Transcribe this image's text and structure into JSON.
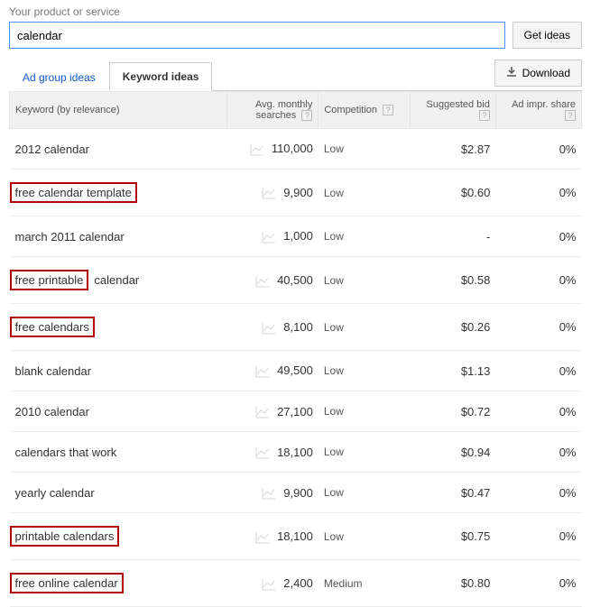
{
  "label": "Your product or service",
  "search": {
    "value": "calendar",
    "button": "Get ideas"
  },
  "tabs": {
    "ad_group": "Ad group ideas",
    "keyword": "Keyword ideas"
  },
  "download": "Download",
  "headers": {
    "keyword": "Keyword (by relevance)",
    "searches": "Avg. monthly searches",
    "competition": "Competition",
    "bid": "Suggested bid",
    "impr": "Ad impr. share"
  },
  "rows": [
    {
      "kw": "2012 calendar",
      "searches": "110,000",
      "comp": "Low",
      "bid": "$2.87",
      "impr": "0%",
      "hl": false
    },
    {
      "kw": "free calendar template",
      "searches": "9,900",
      "comp": "Low",
      "bid": "$0.60",
      "impr": "0%",
      "hl": true
    },
    {
      "kw": "march 2011 calendar",
      "searches": "1,000",
      "comp": "Low",
      "bid": "-",
      "impr": "0%",
      "hl": false
    },
    {
      "kw": "free printable calendar",
      "searches": "40,500",
      "comp": "Low",
      "bid": "$0.58",
      "impr": "0%",
      "hl": true,
      "hl_text": "free printable"
    },
    {
      "kw": "free calendars",
      "searches": "8,100",
      "comp": "Low",
      "bid": "$0.26",
      "impr": "0%",
      "hl": true
    },
    {
      "kw": "blank calendar",
      "searches": "49,500",
      "comp": "Low",
      "bid": "$1.13",
      "impr": "0%",
      "hl": false
    },
    {
      "kw": "2010 calendar",
      "searches": "27,100",
      "comp": "Low",
      "bid": "$0.72",
      "impr": "0%",
      "hl": false
    },
    {
      "kw": "calendars that work",
      "searches": "18,100",
      "comp": "Low",
      "bid": "$0.94",
      "impr": "0%",
      "hl": false
    },
    {
      "kw": "yearly calendar",
      "searches": "9,900",
      "comp": "Low",
      "bid": "$0.47",
      "impr": "0%",
      "hl": false
    },
    {
      "kw": "printable calendars",
      "searches": "18,100",
      "comp": "Low",
      "bid": "$0.75",
      "impr": "0%",
      "hl": true
    },
    {
      "kw": "free online calendar",
      "searches": "2,400",
      "comp": "Medium",
      "bid": "$0.80",
      "impr": "0%",
      "hl": true
    }
  ]
}
